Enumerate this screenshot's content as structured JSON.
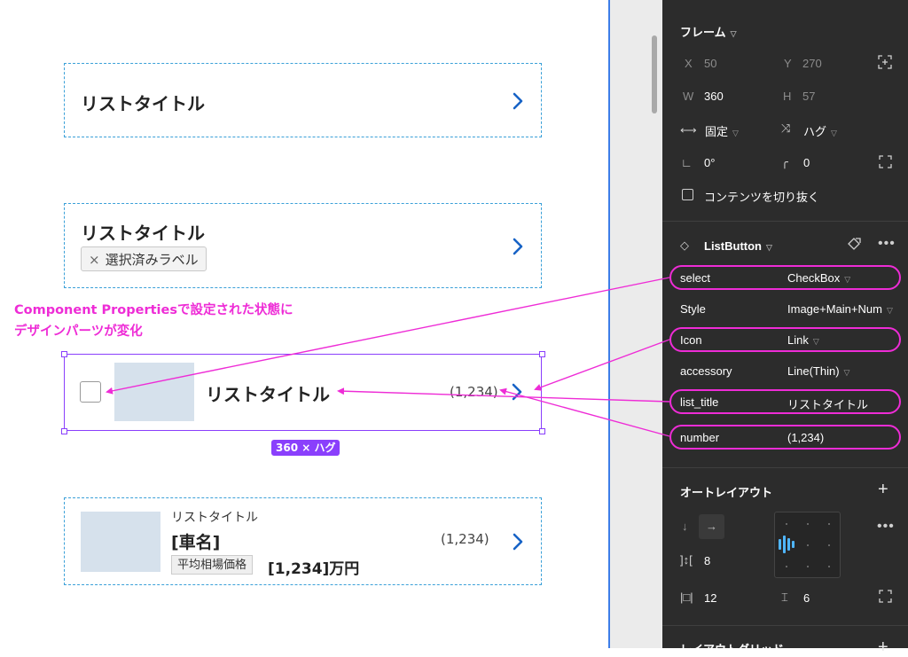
{
  "canvas": {
    "item1": {
      "title": "リストタイトル"
    },
    "item2": {
      "title": "リストタイトル",
      "chip_label": "選択済みラベル",
      "chip_close": "×"
    },
    "item3": {
      "title": "リストタイトル",
      "number": "(1,234)",
      "size_badge": "360 × ハグ"
    },
    "item4": {
      "subtitle": "リストタイトル",
      "car_name": "[車名]",
      "number": "(1,234)",
      "price_label": "平均相場価格",
      "price": "[1,234]万円"
    },
    "annotation": [
      "Component Propertiesで設定された状態に",
      "デザインパーツが変化"
    ],
    "accent_color": "#ee2cd6",
    "chevron_color": "#1763c6"
  },
  "panel": {
    "frame": {
      "title": "フレーム",
      "x_label": "X",
      "x_value": "50",
      "y_label": "Y",
      "y_value": "270",
      "w_label": "W",
      "w_value": "360",
      "h_label": "H",
      "h_value": "57",
      "width_mode": "固定",
      "height_mode": "ハグ",
      "rotation": "0°",
      "radius": "0",
      "clip_content": "コンテンツを切り抜く"
    },
    "component": {
      "name": "ListButton",
      "properties": [
        {
          "label": "select",
          "value": "CheckBox"
        },
        {
          "label": "Style",
          "value": "Image+Main+Num"
        },
        {
          "label": "Icon",
          "value": "Link"
        },
        {
          "label": "accessory",
          "value": "Line(Thin)"
        },
        {
          "label": "list_title",
          "value": "リストタイトル"
        },
        {
          "label": "number",
          "value": "(1,234)"
        }
      ]
    },
    "autolayout": {
      "title": "オートレイアウト",
      "gap": "8",
      "padding_h": "12",
      "padding_v": "6"
    },
    "layout_grid": {
      "title": "レイアウトグリッド"
    }
  }
}
